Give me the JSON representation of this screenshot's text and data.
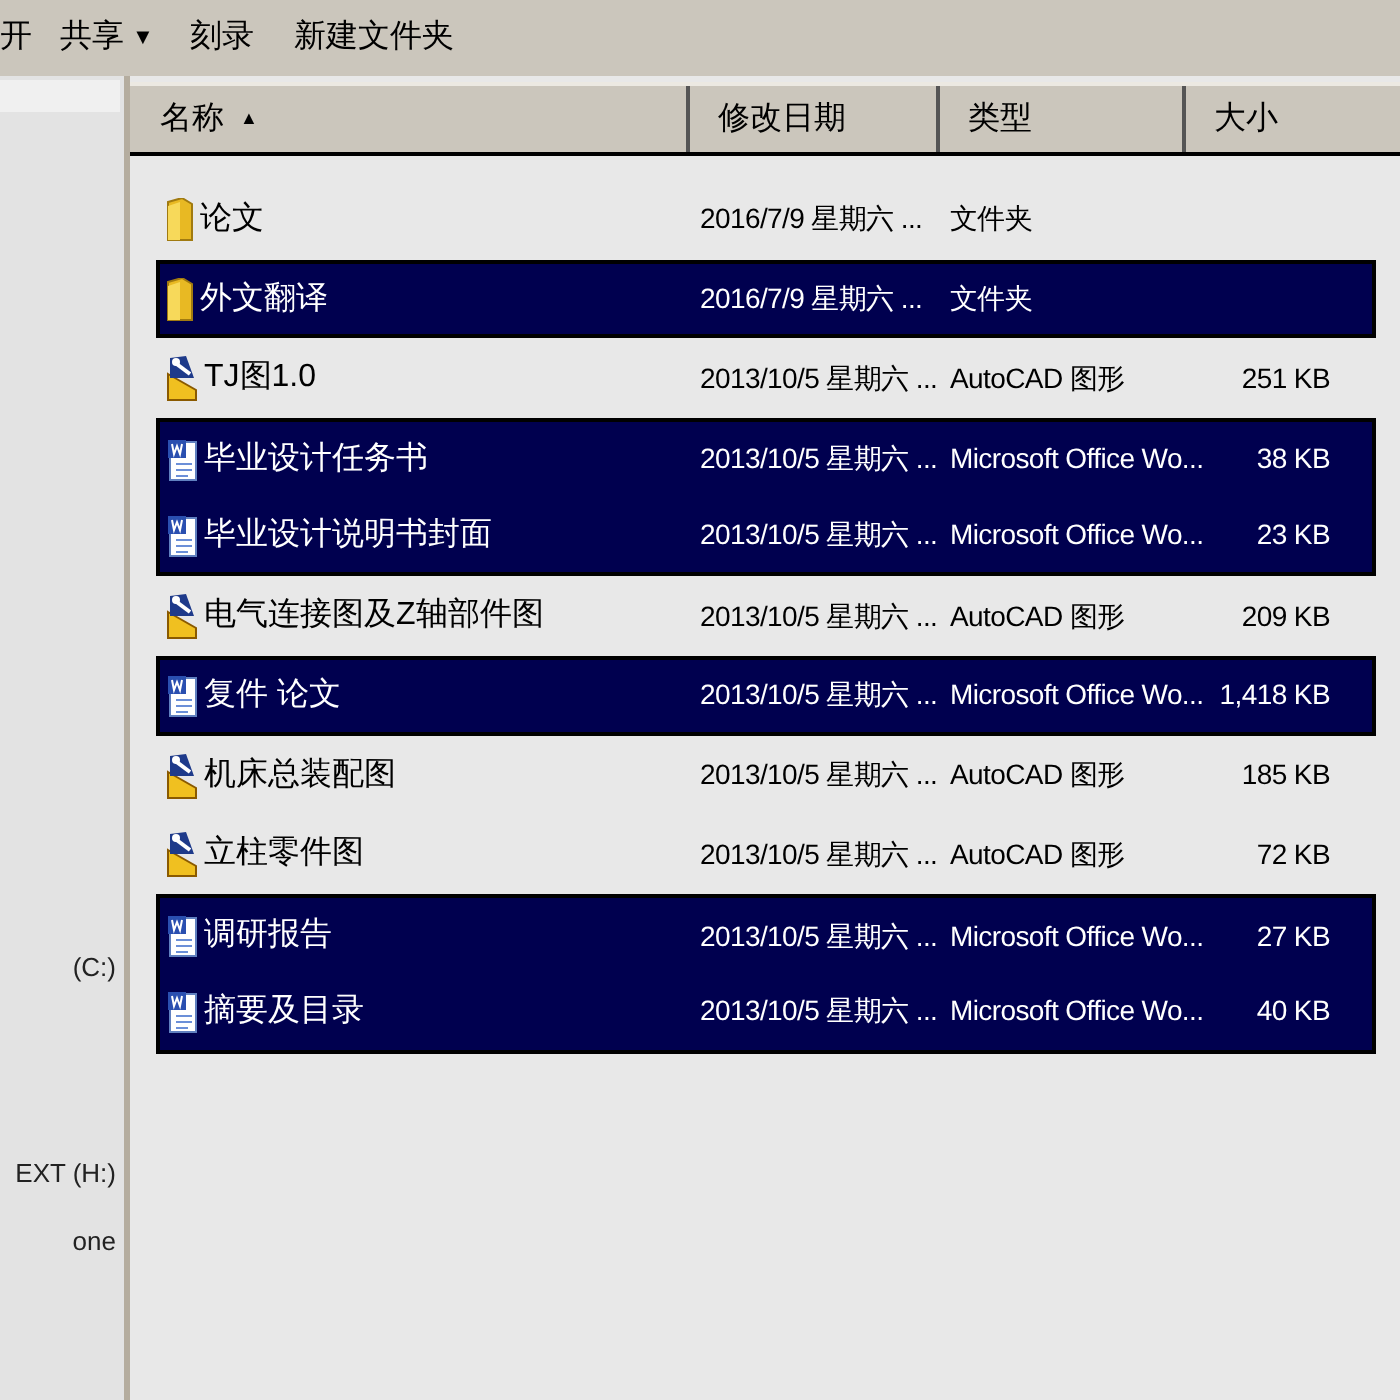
{
  "toolbar": [
    {
      "label": "开"
    },
    {
      "label": "共享",
      "caret": "▼"
    },
    {
      "label": "刻录"
    },
    {
      "label": "新建文件夹"
    }
  ],
  "sidebar": {
    "items": [
      {
        "label": "(C:)"
      },
      {
        "label": "EXT (H:)"
      },
      {
        "label": "one"
      }
    ]
  },
  "table": {
    "columns": [
      {
        "label": "名称",
        "sort": "▲"
      },
      {
        "label": "修改日期"
      },
      {
        "label": "类型"
      },
      {
        "label": "大小"
      }
    ],
    "rows": [
      {
        "kind": "folder",
        "name": "论文",
        "date": "2016/7/9 星期六 ...",
        "type": "文件夹",
        "selected": false
      },
      {
        "kind": "folder",
        "name": "外文翻译",
        "date": "2016/7/9 星期六 ...",
        "type": "文件夹",
        "selected": true
      },
      {
        "kind": "cad",
        "name": "TJ图1.0",
        "date": "2013/10/5 星期六 ...",
        "type": "AutoCAD 图形",
        "size": "251 KB",
        "selected": false
      },
      {
        "kind": "word",
        "name": "毕业设计任务书",
        "date": "2013/10/5 星期六 ...",
        "type": "Microsoft Office Wo...",
        "size": "38 KB",
        "selected": true
      },
      {
        "kind": "word",
        "name": "毕业设计说明书封面",
        "date": "2013/10/5 星期六 ...",
        "type": "Microsoft Office Wo...",
        "size": "23 KB",
        "selected": true
      },
      {
        "kind": "cad",
        "name": "电气连接图及Z轴部件图",
        "date": "2013/10/5 星期六 ...",
        "type": "AutoCAD 图形",
        "size": "209 KB",
        "selected": false
      },
      {
        "kind": "word",
        "name": "复件 论文",
        "date": "2013/10/5 星期六 ...",
        "type": "Microsoft Office Wo...",
        "size": "1,418 KB",
        "selected": true
      },
      {
        "kind": "cad",
        "name": "机床总装配图",
        "date": "2013/10/5 星期六 ...",
        "type": "AutoCAD 图形",
        "size": "185 KB",
        "selected": false
      },
      {
        "kind": "cad",
        "name": "立柱零件图",
        "date": "2013/10/5 星期六 ...",
        "type": "AutoCAD 图形",
        "size": "72 KB",
        "selected": false
      },
      {
        "kind": "word",
        "name": "调研报告",
        "date": "2013/10/5 星期六 ...",
        "type": "Microsoft Office Wo...",
        "size": "27 KB",
        "selected": true
      },
      {
        "kind": "word",
        "name": "摘要及目录",
        "date": "2013/10/5 星期六 ...",
        "type": "Microsoft Office Wo...",
        "size": "40 KB",
        "selected": true
      }
    ]
  }
}
